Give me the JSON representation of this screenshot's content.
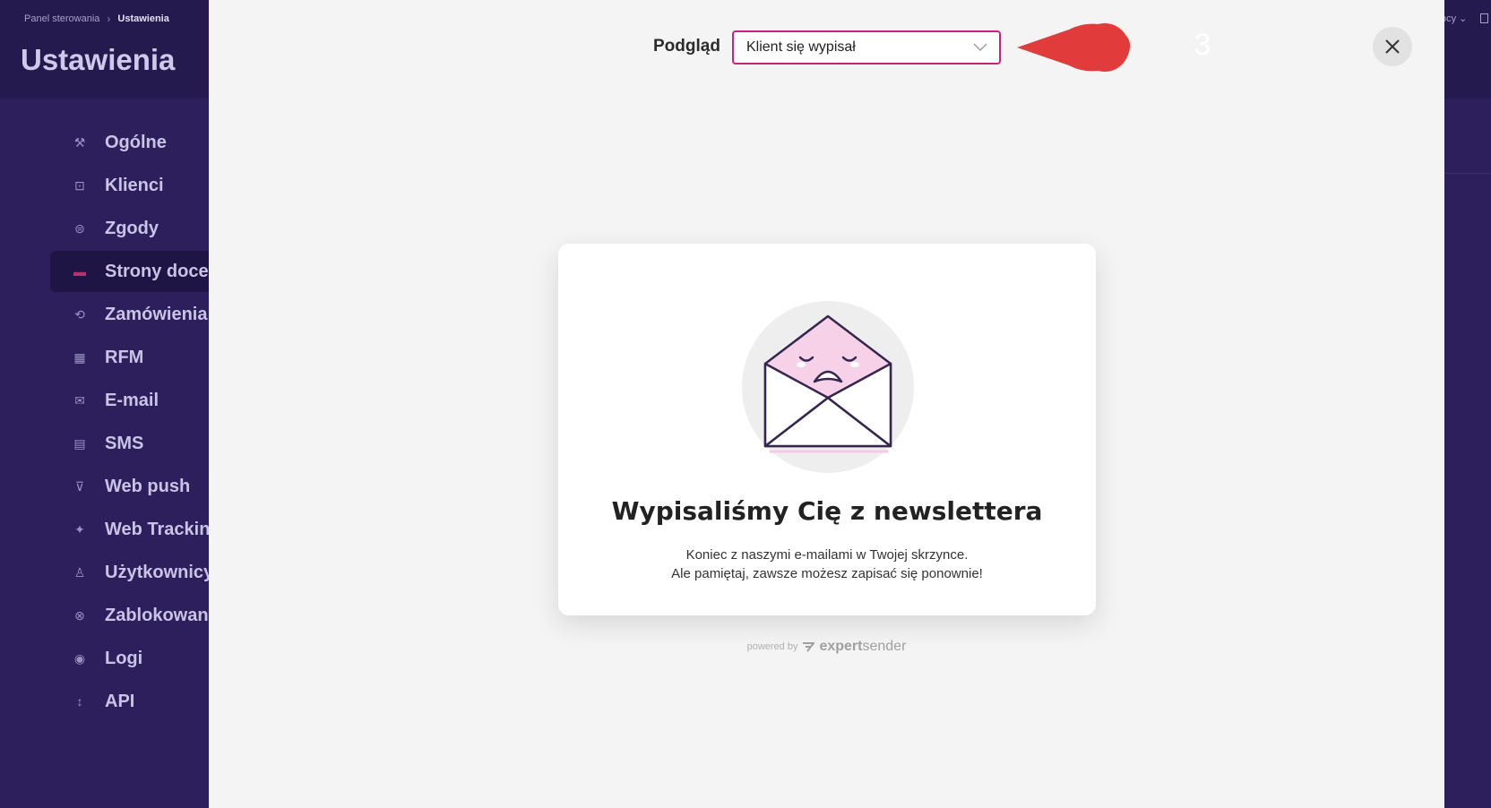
{
  "header": {
    "breadcrumb": [
      "Panel sterowania",
      "Ustawienia"
    ],
    "title": "Ustawienia",
    "right_text": "ocy ⌄"
  },
  "sidebar": {
    "items": [
      {
        "label": "Ogólne",
        "icon": "tools-icon",
        "glyph": "⚒"
      },
      {
        "label": "Klienci",
        "icon": "user-frame-icon",
        "glyph": "⊡"
      },
      {
        "label": "Zgody",
        "icon": "consent-icon",
        "glyph": "⊜"
      },
      {
        "label": "Strony docel",
        "icon": "landing-page-icon",
        "glyph": "▬",
        "active": true
      },
      {
        "label": "Zamówienia",
        "icon": "orders-icon",
        "glyph": "⟲"
      },
      {
        "label": "RFM",
        "icon": "grid-icon",
        "glyph": "▦"
      },
      {
        "label": "E-mail",
        "icon": "mail-icon",
        "glyph": "✉"
      },
      {
        "label": "SMS",
        "icon": "sms-icon",
        "glyph": "▤"
      },
      {
        "label": "Web push",
        "icon": "web-push-icon",
        "glyph": "⊽"
      },
      {
        "label": "Web Tracking",
        "icon": "tracking-icon",
        "glyph": "✦"
      },
      {
        "label": "Użytkownicy",
        "icon": "users-icon",
        "glyph": "♙"
      },
      {
        "label": "Zablokowani",
        "icon": "blocked-icon",
        "glyph": "⊗"
      },
      {
        "label": "Logi",
        "icon": "eye-icon",
        "glyph": "◉"
      },
      {
        "label": "API",
        "icon": "api-icon",
        "glyph": "↕"
      }
    ]
  },
  "modal": {
    "preview_label": "Podgląd",
    "select_value": "Klient się wypisał",
    "annotation_number": "3",
    "card": {
      "title": "Wypisaliśmy Cię z newslettera",
      "line1": "Koniec z naszymi e-mailami w Twojej skrzynce.",
      "line2": "Ale pamiętaj, zawsze możesz zapisać się ponownie!"
    },
    "powered_by": "powered by",
    "brand_bold": "expert",
    "brand_rest": "sender"
  },
  "colors": {
    "sidebar_bg": "#2c1f5c",
    "header_bg": "#241a4e",
    "accent": "#c4237f",
    "annotation": "#e23b3b"
  }
}
